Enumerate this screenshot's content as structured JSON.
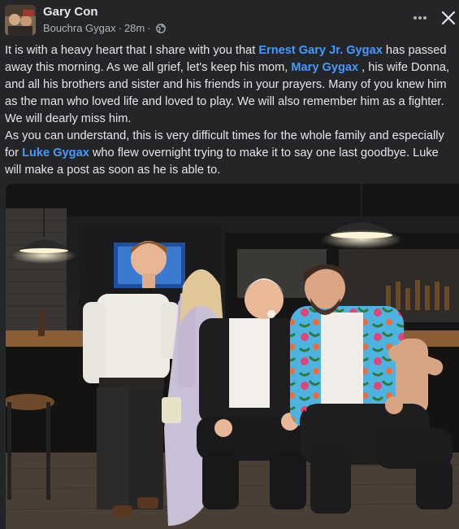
{
  "header": {
    "group_name": "Gary Con",
    "author": "Bouchra Gygax",
    "time": "28m",
    "separator": "·",
    "privacy_icon": "globe-icon",
    "more_icon": "more-dots-icon",
    "close_icon": "close-icon"
  },
  "post": {
    "p1_a": "It is with a heavy heart that I share with you that ",
    "mention_1": "Ernest Gary Jr. Gygax",
    "p1_b": " has passed away this morning. As we all grief, let's keep his mom, ",
    "mention_2": "Mary Gygax",
    "p1_c": " , his wife Donna, and all his brothers and sister and his friends in your prayers. Many of you knew him as the man who loved life and loved to play. We will also remember him as a fighter. We will dearly miss him.",
    "p2_a": "As you can understand, this is very difficult times for the whole family and especially for ",
    "mention_3": "Luke Gygax",
    "p2_b": " who flew overnight trying to make it to say one last goodbye. Luke will make a post as soon as he is able to."
  },
  "photo": {
    "subject": "four-people-at-bar-photo"
  },
  "colors": {
    "background": "#242526",
    "text": "#e4e6eb",
    "secondary_text": "#b0b3b8",
    "link": "#4599ff"
  }
}
